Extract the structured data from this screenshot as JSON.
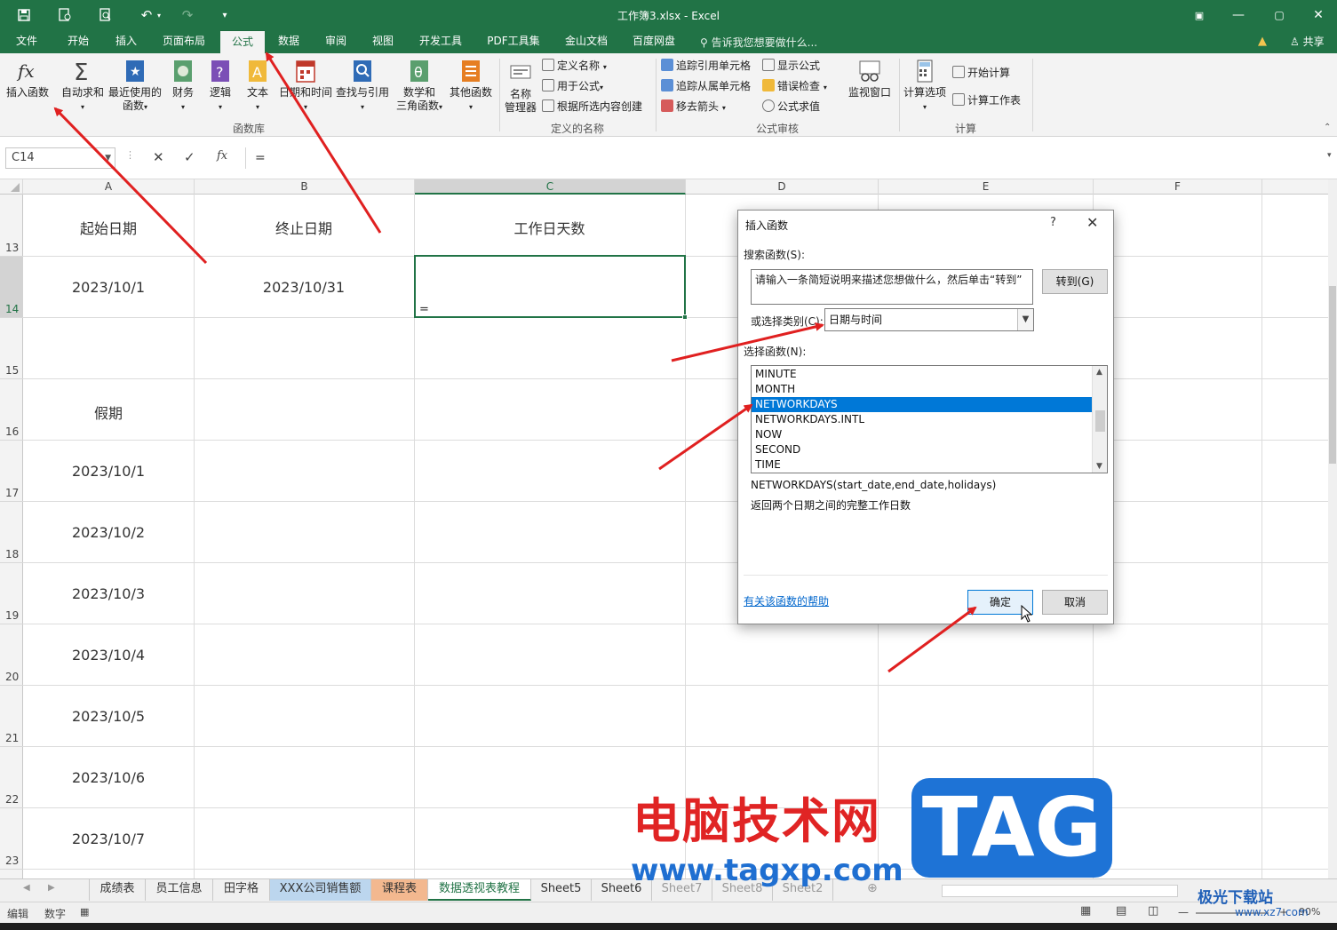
{
  "window": {
    "title": "工作簿3.xlsx - Excel",
    "colors": {
      "accent": "#217346",
      "selection": "#0078d7",
      "arrow": "#e02020"
    }
  },
  "menu": {
    "tabs": [
      "文件",
      "开始",
      "插入",
      "页面布局",
      "公式",
      "数据",
      "审阅",
      "视图",
      "开发工具",
      "PDF工具集",
      "金山文档",
      "百度网盘"
    ],
    "active_tab": "公式",
    "tell_me": "告诉我您想要做什么...",
    "share": "共享"
  },
  "ribbon": {
    "insert_function": "插入函数",
    "autosum": "自动求和",
    "recent_l1": "最近使用的",
    "recent_l2": "函数",
    "financial": "财务",
    "logical": "逻辑",
    "text": "文本",
    "datetime": "日期和时间",
    "lookup": "查找与引用",
    "math_l1": "数学和",
    "math_l2": "三角函数",
    "more": "其他函数",
    "group_function_library": "函数库",
    "name_manager_l1": "名称",
    "name_manager_l2": "管理器",
    "define_name": "定义名称",
    "use_in_formula": "用于公式",
    "create_from_selection": "根据所选内容创建",
    "group_defined_names": "定义的名称",
    "trace_precedents": "追踪引用单元格",
    "trace_dependents": "追踪从属单元格",
    "remove_arrows": "移去箭头",
    "show_formulas": "显示公式",
    "error_checking": "错误检查",
    "evaluate_formula": "公式求值",
    "watch_window": "监视窗口",
    "group_formula_auditing": "公式审核",
    "calc_options": "计算选项",
    "calc_now": "开始计算",
    "calc_sheet": "计算工作表",
    "group_calculation": "计算"
  },
  "formula_bar": {
    "name_box": "C14",
    "formula": "="
  },
  "grid": {
    "columns": [
      "A",
      "B",
      "C",
      "D",
      "E",
      "F"
    ],
    "rows": [
      "13",
      "14",
      "15",
      "16",
      "17",
      "18",
      "19",
      "20",
      "21",
      "22",
      "23"
    ],
    "header_a": "起始日期",
    "header_b": "终止日期",
    "header_c": "工作日天数",
    "start_date": "2023/10/1",
    "end_date": "2023/10/31",
    "holiday_label": "假期",
    "holidays": [
      "2023/10/1",
      "2023/10/2",
      "2023/10/3",
      "2023/10/4",
      "2023/10/5",
      "2023/10/6",
      "2023/10/7"
    ],
    "active_cell_text": "="
  },
  "dialog": {
    "title": "插入函数",
    "help": "?",
    "search_label": "搜索函数(S):",
    "search_text": "请输入一条简短说明来描述您想做什么，然后单击“转到”",
    "goto": "转到(G)",
    "category_label": "或选择类别(C):",
    "category_value": "日期与时间",
    "select_label": "选择函数(N):",
    "functions": [
      "MINUTE",
      "MONTH",
      "NETWORKDAYS",
      "NETWORKDAYS.INTL",
      "NOW",
      "SECOND",
      "TIME"
    ],
    "selected_function": "NETWORKDAYS",
    "signature": "NETWORKDAYS(start_date,end_date,holidays)",
    "description": "返回两个日期之间的完整工作日数",
    "help_link": "有关该函数的帮助",
    "ok": "确定",
    "cancel": "取消"
  },
  "sheets": {
    "tabs": [
      "成绩表",
      "员工信息",
      "田字格",
      "XXX公司销售额",
      "课程表",
      "数据透视表教程",
      "Sheet5",
      "Sheet6",
      "Sheet7",
      "Sheet8",
      "Sheet2"
    ],
    "active": "数据透视表教程"
  },
  "status": {
    "mode": "编辑",
    "num": "数字",
    "zoom": "90%"
  },
  "watermark": {
    "cn": "电脑技术网",
    "url": "www.tagxp.com",
    "tag": "TAG",
    "brand": "极光下载站",
    "brand_url": "www.xz7.com"
  }
}
